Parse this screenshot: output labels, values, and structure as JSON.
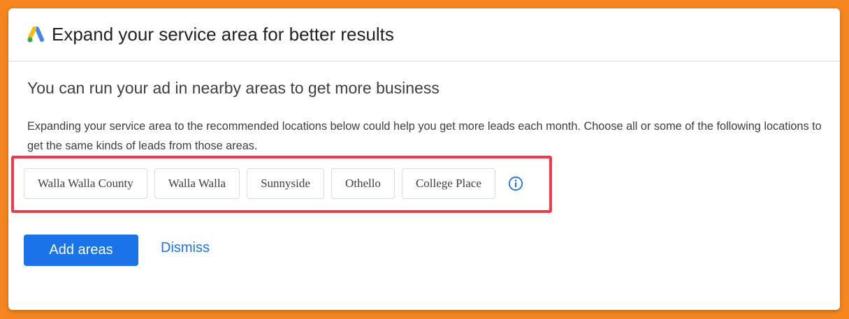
{
  "header": {
    "logo_icon": "google-ads-logo-icon",
    "title": "Expand your service area for better results"
  },
  "body": {
    "subtitle": "You can run your ad in nearby areas to get more business",
    "description": "Expanding your service area to the recommended locations below could help you get more leads each month. Choose all or some of the following locations to get the same kinds of leads from those areas."
  },
  "locations": {
    "chips": [
      "Walla Walla County",
      "Walla Walla",
      "Sunnyside",
      "Othello",
      "College Place"
    ],
    "info_icon": "info-icon"
  },
  "actions": {
    "add_label": "Add areas",
    "dismiss_label": "Dismiss"
  },
  "colors": {
    "background": "#f5861f",
    "accent": "#1a73e8",
    "highlight": "#ef3a4e"
  }
}
